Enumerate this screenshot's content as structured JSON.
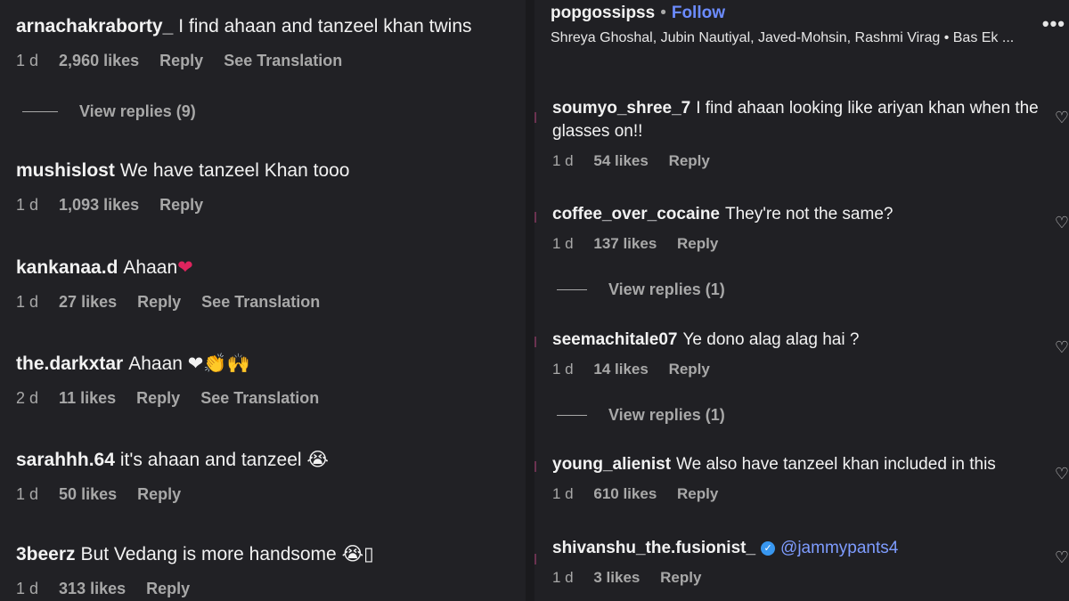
{
  "left": {
    "comments": [
      {
        "user": "arnachakraborty_",
        "text": "I find ahaan and tanzeel khan twins",
        "time": "1 d",
        "likes": "2,960 likes",
        "reply": "Reply",
        "translation": "See Translation"
      },
      {
        "user": "mushislost",
        "text": "We have tanzeel Khan tooo",
        "time": "1 d",
        "likes": "1,093 likes",
        "reply": "Reply"
      },
      {
        "user": "kankanaa.d",
        "text": "Ahaan",
        "emoji": "❤",
        "time": "1 d",
        "likes": "27 likes",
        "reply": "Reply",
        "translation": "See Translation"
      },
      {
        "user": "the.darkxtar",
        "text": "Ahaan",
        "emoji": "❤👏🙌",
        "time": "2 d",
        "likes": "11 likes",
        "reply": "Reply",
        "translation": "See Translation"
      },
      {
        "user": "sarahhh.64",
        "text": "it's ahaan and tanzeel",
        "emoji": "😭",
        "time": "1 d",
        "likes": "50 likes",
        "reply": "Reply"
      },
      {
        "user": "3beerz",
        "text": "But Vedang is more handsome",
        "emoji": "😭▯",
        "time": "1 d",
        "likes": "313 likes",
        "reply": "Reply"
      }
    ],
    "view_replies": "View replies (9)"
  },
  "right": {
    "header": {
      "account": "popgossipss",
      "follow": "Follow",
      "audio": "Shreya Ghoshal, Jubin Nautiyal, Javed-Mohsin, Rashmi Virag • Bas Ek ..."
    },
    "comments": [
      {
        "user": "soumyo_shree_7",
        "text": "I find ahaan looking like ariyan khan when the glasses on!!",
        "time": "1 d",
        "likes": "54 likes",
        "reply": "Reply"
      },
      {
        "user": "coffee_over_cocaine",
        "text": "They're not the same?",
        "time": "1 d",
        "likes": "137 likes",
        "reply": "Reply"
      },
      {
        "user": "seemachitale07",
        "text": "Ye dono alag alag hai ?",
        "time": "1 d",
        "likes": "14 likes",
        "reply": "Reply"
      },
      {
        "user": "young_alienist",
        "text": "We also have tanzeel khan included in this",
        "time": "1 d",
        "likes": "610 likes",
        "reply": "Reply"
      },
      {
        "user": "shivanshu_the.fusionist_",
        "text": "@jammypants4",
        "time": "1 d",
        "likes": "3 likes",
        "reply": "Reply"
      }
    ],
    "view_replies_1": "View replies (1)",
    "view_replies_2": "View replies (1)"
  }
}
